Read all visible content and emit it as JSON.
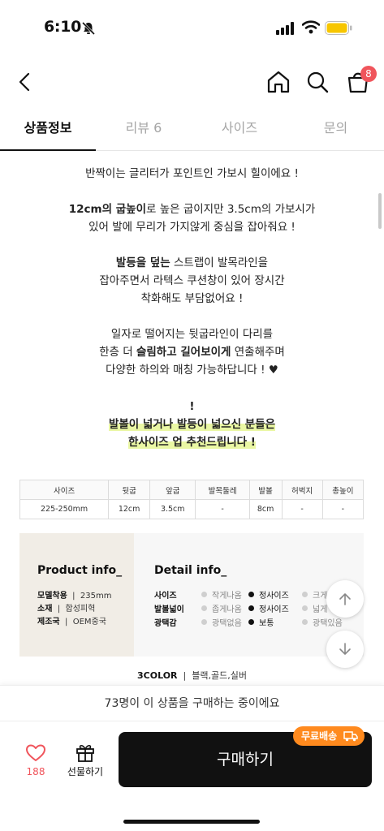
{
  "status": {
    "time": "6:10"
  },
  "header": {
    "cart_badge": "8"
  },
  "tabs": [
    {
      "label": "상품정보",
      "active": true
    },
    {
      "label": "리뷰 6",
      "active": false
    },
    {
      "label": "사이즈",
      "active": false
    },
    {
      "label": "문의",
      "active": false
    }
  ],
  "description": {
    "line1": "반짝이는 글리터가 포인트인 가보시 힐이에요 !",
    "p2_bold": "12cm의 굽높이",
    "p2_rest": "로 높은 굽이지만 3.5cm의 가보시가",
    "p2_line2": "있어 발에 무리가 가지않게 중심을 잡아줘요 !",
    "p3_bold": "발등을 덮는",
    "p3_rest": " 스트랩이 발목라인을",
    "p3_line2": "잡아주면서 라텍스 쿠션창이 있어 장시간",
    "p3_line3": "착화해도 부담없어요 !",
    "p4_line1": "일자로 떨어지는 뒷굽라인이 다리를",
    "p4_pre": "한층 더 ",
    "p4_bold": "슬림하고 길어보이게",
    "p4_post": " 연출해주며",
    "p4_line3": "다양한 하의와 매칭 가능하답니다 ! ♥",
    "notice_mark": "!",
    "notice_line1": "발볼이 넓거나 발등이 넓으신 분들은",
    "notice_line2": "한사이즈 업 추천드립니다 !"
  },
  "size_table": {
    "headers": [
      "사이즈",
      "뒷굽",
      "앞굽",
      "발목둘레",
      "발볼",
      "허벅지",
      "총높이"
    ],
    "values": [
      "225-250mm",
      "12cm",
      "3.5cm",
      "-",
      "8cm",
      "-",
      "-"
    ]
  },
  "product_info": {
    "title": "Product info_",
    "rows": [
      {
        "label": "모델착용",
        "value": "235mm"
      },
      {
        "label": "소재",
        "value": "합성피혁"
      },
      {
        "label": "제조국",
        "value": "OEM중국"
      }
    ]
  },
  "detail_info": {
    "title": "Detail info_",
    "rows": [
      {
        "label": "사이즈",
        "options": [
          "작게나옴",
          "정사이즈",
          "크게"
        ],
        "selected": 1
      },
      {
        "label": "발볼넓이",
        "options": [
          "좁게나옴",
          "정사이즈",
          "넓게"
        ],
        "selected": 1
      },
      {
        "label": "광택감",
        "options": [
          "광택없음",
          "보통",
          "광택있음"
        ],
        "selected": 1
      }
    ]
  },
  "colors": {
    "label": "3COLOR",
    "values": "블랙,골드,실버"
  },
  "purchase_count": "73명이 이 상품을 구매하는 중이에요",
  "bottom": {
    "like_count": "188",
    "gift_label": "선물하기",
    "buy_label": "구매하기",
    "free_shipping": "무료배송"
  },
  "colors_theme": {
    "accent_red": "#f0555c",
    "orange": "#ff8a1e",
    "highlight": "#eaf7a4",
    "dark": "#111111"
  }
}
